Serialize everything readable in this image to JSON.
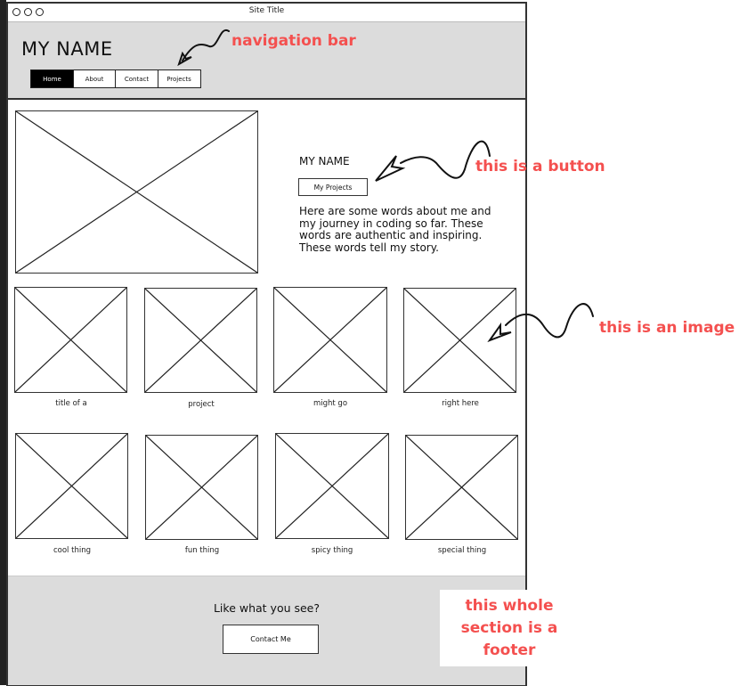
{
  "window": {
    "title": "Site Title",
    "controls": [
      "circle-icon",
      "circle-icon",
      "circle-icon"
    ]
  },
  "header": {
    "brand": "MY NAME",
    "nav": [
      {
        "label": "Home",
        "active": true
      },
      {
        "label": "About",
        "active": false
      },
      {
        "label": "Contact",
        "active": false
      },
      {
        "label": "Projects",
        "active": false
      }
    ]
  },
  "hero": {
    "image": "image-placeholder",
    "name": "MY NAME",
    "button_label": "My Projects",
    "text": "Here are some words about me and my journey in coding so far. These words are authentic and inspiring. These words tell my story."
  },
  "gallery": {
    "row1": [
      {
        "caption": "title of a"
      },
      {
        "caption": "project"
      },
      {
        "caption": "might go"
      },
      {
        "caption": "right here"
      }
    ],
    "row2": [
      {
        "caption": "cool thing"
      },
      {
        "caption": "fun thing"
      },
      {
        "caption": "spicy thing"
      },
      {
        "caption": "special thing"
      }
    ]
  },
  "footer": {
    "text": "Like what you see?",
    "button_label": "Contact Me"
  },
  "annotations": {
    "color": "#f4504f",
    "nav": "navigation bar",
    "button": "this is a button",
    "image": "this is an image",
    "footer": "this whole section is a footer"
  }
}
